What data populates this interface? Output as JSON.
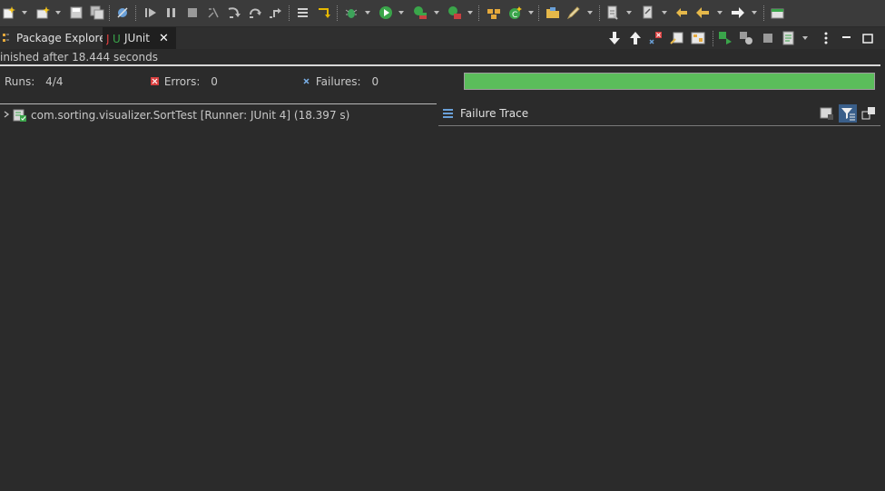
{
  "toolbar": {
    "icons": [
      "new-icon",
      "save-icon",
      "save-all-icon",
      "skip-breakpoints-icon",
      "resume-icon",
      "suspend-icon",
      "terminate-icon",
      "disconnect-icon",
      "step-into-icon",
      "step-over-icon",
      "step-return-icon",
      "new-java-class-icon",
      "debug-icon",
      "run-icon",
      "coverage-icon",
      "run-external-icon",
      "open-type-icon",
      "new-package-icon",
      "open-folder-icon",
      "pen-icon",
      "annotation-icon",
      "pin-icon",
      "back-icon",
      "forward-icon",
      "perspective-icon"
    ]
  },
  "tabs": [
    {
      "label": "Package Explorer",
      "icon": "package-explorer-icon",
      "active": false
    },
    {
      "label": "JUnit",
      "icon": "junit-icon",
      "active": true,
      "close": "✕"
    }
  ],
  "view_toolbar": {
    "icons": [
      "next-failure-icon",
      "previous-failure-icon",
      "failures-only-icon",
      "scroll-lock-icon",
      "show-as-layout-icon",
      "rerun-test-icon",
      "rerun-failed-first-icon",
      "stop-icon",
      "history-icon",
      "view-menu-icon",
      "minimize-icon",
      "maximize-icon"
    ]
  },
  "status": {
    "text": "inished after 18.444 seconds"
  },
  "counters": {
    "runs_label": "Runs:",
    "runs_value": "4/4",
    "errors_label": "Errors:",
    "errors_value": "0",
    "failures_label": "Failures:",
    "failures_value": "0"
  },
  "progress": {
    "fraction": 1.0,
    "color": "#5bbd5b"
  },
  "test_tree": {
    "items": [
      {
        "label": "com.sorting.visualizer.SortTest [Runner: JUnit 4] (18.397 s)",
        "expanded": false
      }
    ]
  },
  "failure_trace": {
    "title": "Failure Trace"
  }
}
